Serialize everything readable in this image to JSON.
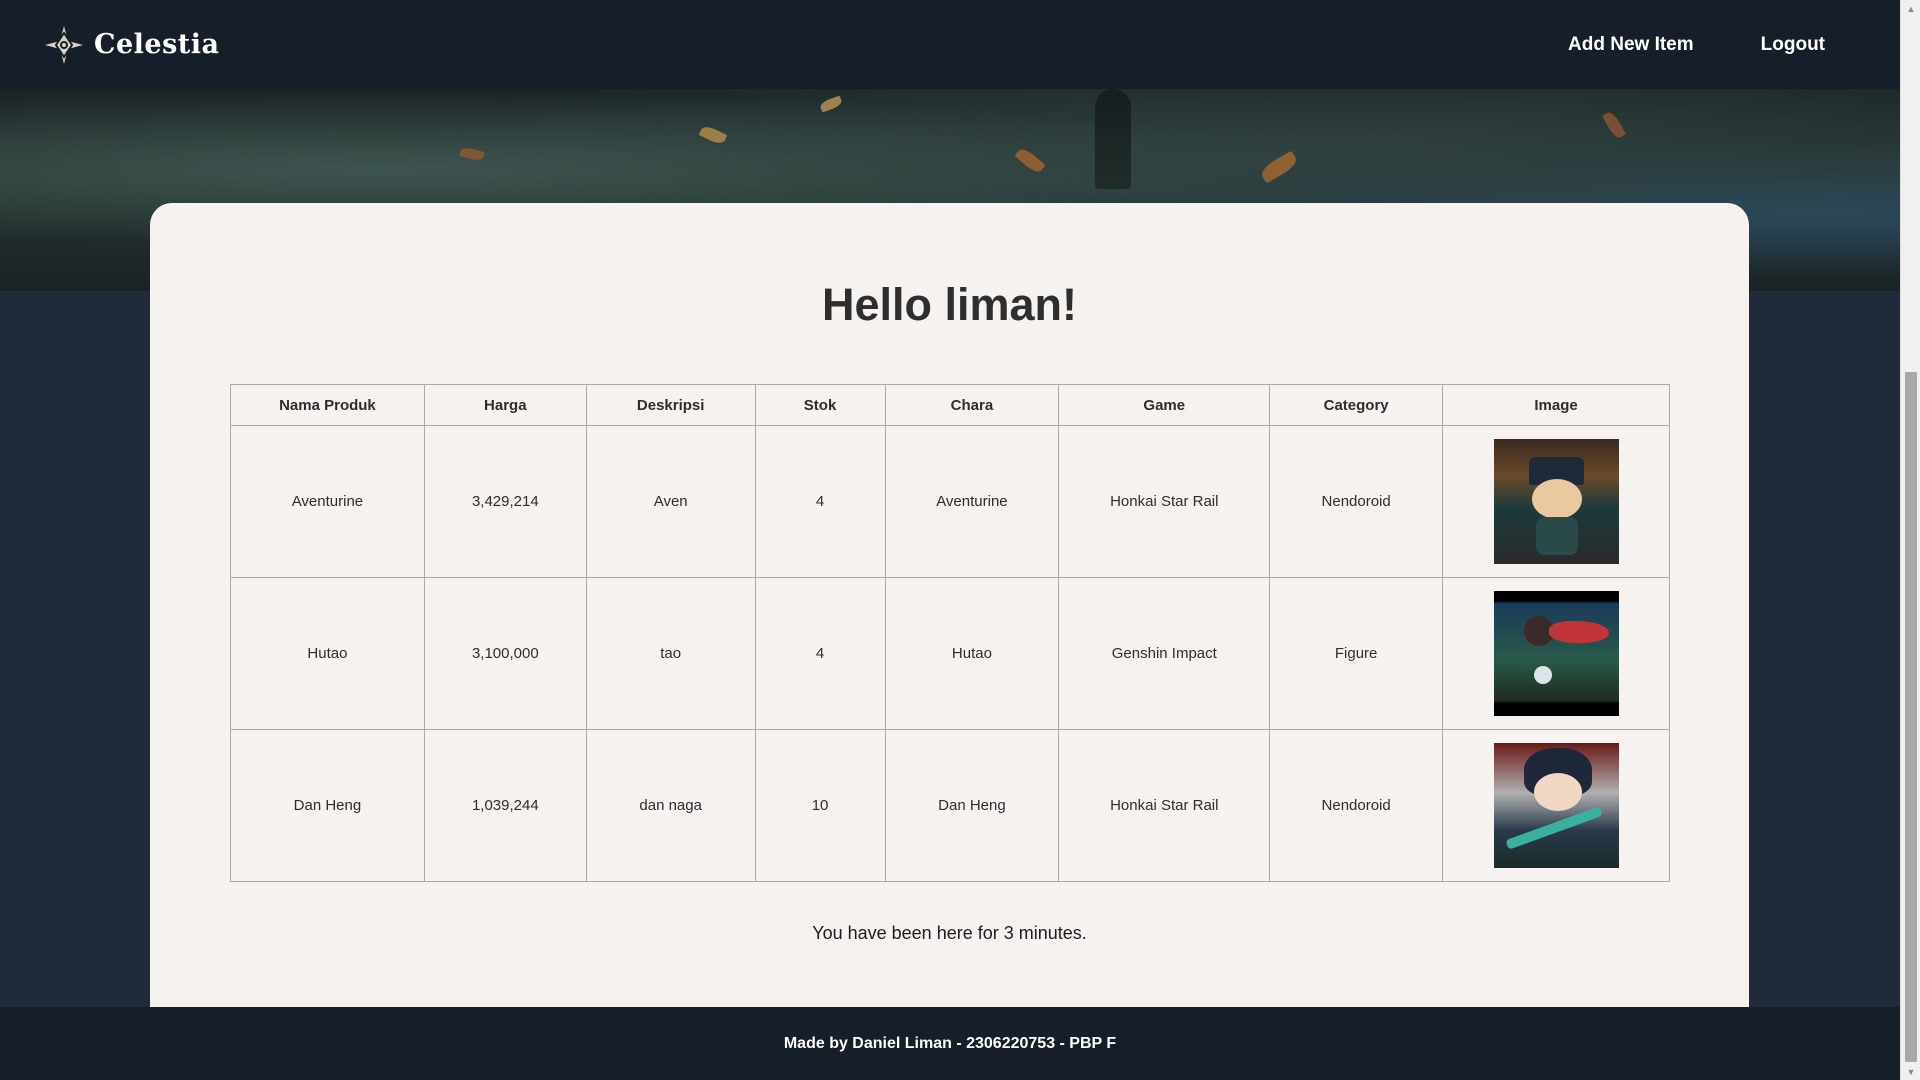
{
  "nav": {
    "brand": "Celestia",
    "brand_icon": "compass-star-icon",
    "links": [
      "Add New Item",
      "Logout"
    ]
  },
  "main": {
    "greeting": "Hello liman!",
    "table": {
      "headers": [
        "Nama Produk",
        "Harga",
        "Deskripsi",
        "Stok",
        "Chara",
        "Game",
        "Category",
        "Image"
      ],
      "rows": [
        [
          "Aventurine",
          "3,429,214",
          "Aven",
          "4",
          "Aventurine",
          "Honkai Star Rail",
          "Nendoroid"
        ],
        [
          "Hutao",
          "3,100,000",
          "tao",
          "4",
          "Hutao",
          "Genshin Impact",
          "Figure"
        ],
        [
          "Dan Heng",
          "1,039,244",
          "dan naga",
          "10",
          "Dan Heng",
          "Honkai Star Rail",
          "Nendoroid"
        ]
      ]
    },
    "timer_text": "You have been here for 3 minutes."
  },
  "footer": {
    "text": "Made by Daniel Liman - 2306220753 - PBP F"
  },
  "colors": {
    "navbar": "#161e2a",
    "page_bg": "#1f2a3b",
    "card": "#f5f2f0"
  }
}
